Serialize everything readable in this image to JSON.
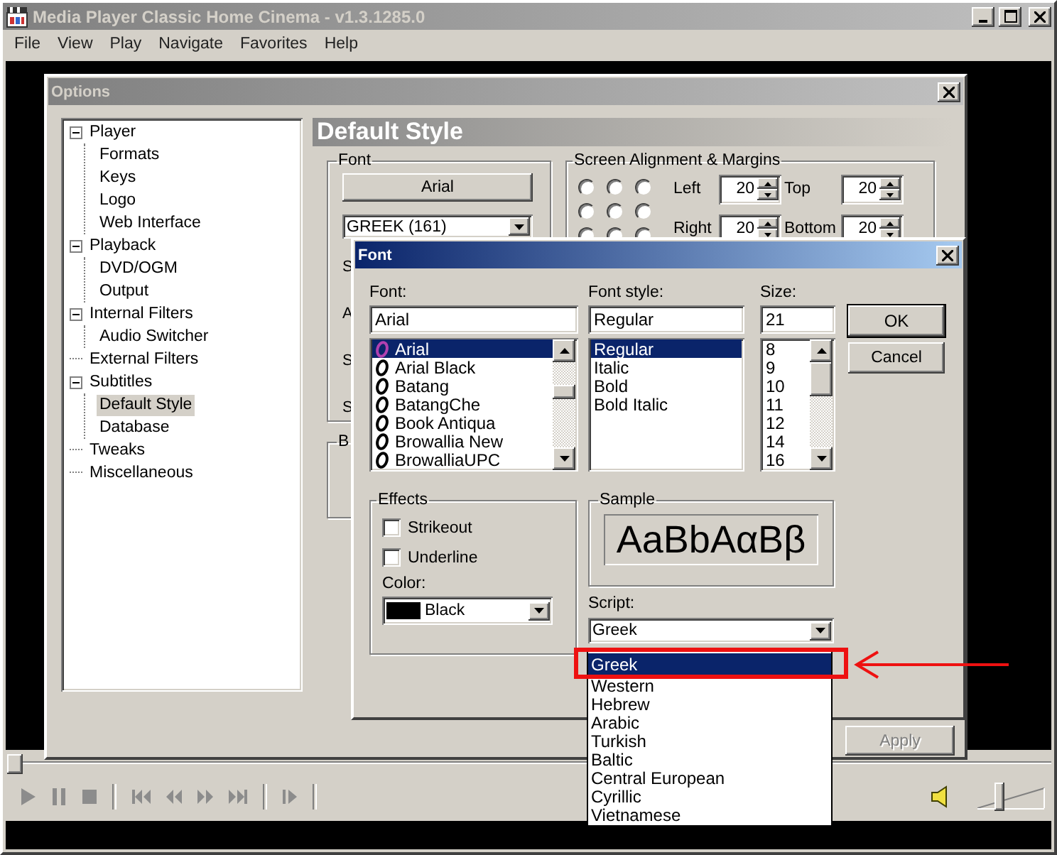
{
  "main_window": {
    "title": "Media Player Classic Home Cinema - v1.3.1285.0",
    "menu": [
      "File",
      "View",
      "Play",
      "Navigate",
      "Favorites",
      "Help"
    ]
  },
  "options": {
    "title": "Options",
    "tree": [
      {
        "label": "Player",
        "expanded": true,
        "selected": false,
        "children": [
          {
            "label": "Formats",
            "selected": false
          },
          {
            "label": "Keys",
            "selected": false
          },
          {
            "label": "Logo",
            "selected": false
          },
          {
            "label": "Web Interface",
            "selected": false
          }
        ]
      },
      {
        "label": "Playback",
        "expanded": true,
        "selected": false,
        "children": [
          {
            "label": "DVD/OGM",
            "selected": false
          },
          {
            "label": "Output",
            "selected": false
          }
        ]
      },
      {
        "label": "Internal Filters",
        "expanded": true,
        "selected": false,
        "children": [
          {
            "label": "Audio Switcher",
            "selected": false
          }
        ]
      },
      {
        "label": "External Filters",
        "selected": false
      },
      {
        "label": "Subtitles",
        "expanded": true,
        "selected": false,
        "children": [
          {
            "label": "Default Style",
            "selected": true
          },
          {
            "label": "Database",
            "selected": false
          }
        ]
      },
      {
        "label": "Tweaks",
        "selected": false
      },
      {
        "label": "Miscellaneous",
        "selected": false
      }
    ],
    "page_title": "Default Style",
    "font_group": {
      "title": "Font",
      "font_button": "Arial",
      "charset": "GREEK (161)",
      "cut_labels": [
        "S",
        "A",
        "S",
        "S"
      ]
    },
    "cut_group_title": "B",
    "alignment": {
      "title": "Screen Alignment & Margins",
      "positions": [
        {
          "selected": false
        },
        {
          "selected": false
        },
        {
          "selected": false
        },
        {
          "selected": false
        },
        {
          "selected": false
        },
        {
          "selected": false
        },
        {
          "selected": false
        },
        {
          "selected": false
        },
        {
          "selected": false
        }
      ],
      "margins": [
        {
          "label": "Left",
          "value": "20"
        },
        {
          "label": "Top",
          "value": "20"
        },
        {
          "label": "Right",
          "value": "20"
        },
        {
          "label": "Bottom",
          "value": "20"
        }
      ]
    },
    "apply_button": {
      "label": "Apply",
      "disabled": true
    }
  },
  "font_dialog": {
    "title": "Font",
    "font_label": "Font:",
    "font_value": "Arial",
    "fonts": [
      {
        "name": "Arial",
        "selected": true
      },
      {
        "name": "Arial Black",
        "selected": false
      },
      {
        "name": "Batang",
        "selected": false
      },
      {
        "name": "BatangChe",
        "selected": false
      },
      {
        "name": "Book Antiqua",
        "selected": false
      },
      {
        "name": "Browallia New",
        "selected": false
      },
      {
        "name": "BrowalliaUPC",
        "selected": false
      }
    ],
    "style_label": "Font style:",
    "style_value": "Regular",
    "styles": [
      {
        "name": "Regular",
        "selected": true
      },
      {
        "name": "Italic",
        "selected": false
      },
      {
        "name": "Bold",
        "selected": false
      },
      {
        "name": "Bold Italic",
        "selected": false
      }
    ],
    "size_label": "Size:",
    "size_value": "21",
    "sizes": [
      {
        "name": "8",
        "selected": false
      },
      {
        "name": "9",
        "selected": false
      },
      {
        "name": "10",
        "selected": false
      },
      {
        "name": "11",
        "selected": false
      },
      {
        "name": "12",
        "selected": false
      },
      {
        "name": "14",
        "selected": false
      },
      {
        "name": "16",
        "selected": false
      }
    ],
    "ok": "OK",
    "cancel": "Cancel",
    "effects": {
      "title": "Effects",
      "checks": [
        {
          "label": "Strikeout",
          "checked": false
        },
        {
          "label": "Underline",
          "checked": false
        }
      ],
      "color_label": "Color:",
      "color_value": "Black",
      "color": "#000000"
    },
    "sample": {
      "title": "Sample",
      "text": "AaBbAαBβ"
    },
    "script_label": "Script:",
    "script_value": "Greek",
    "scripts": [
      {
        "name": "Greek",
        "selected": true
      },
      {
        "name": "Western",
        "selected": false
      },
      {
        "name": "Hebrew",
        "selected": false
      },
      {
        "name": "Arabic",
        "selected": false
      },
      {
        "name": "Turkish",
        "selected": false
      },
      {
        "name": "Baltic",
        "selected": false
      },
      {
        "name": "Central European",
        "selected": false
      },
      {
        "name": "Cyrillic",
        "selected": false
      },
      {
        "name": "Vietnamese",
        "selected": false
      }
    ]
  },
  "player": {
    "seek": {
      "level": 0
    },
    "volume": {
      "level": 0.32
    }
  }
}
